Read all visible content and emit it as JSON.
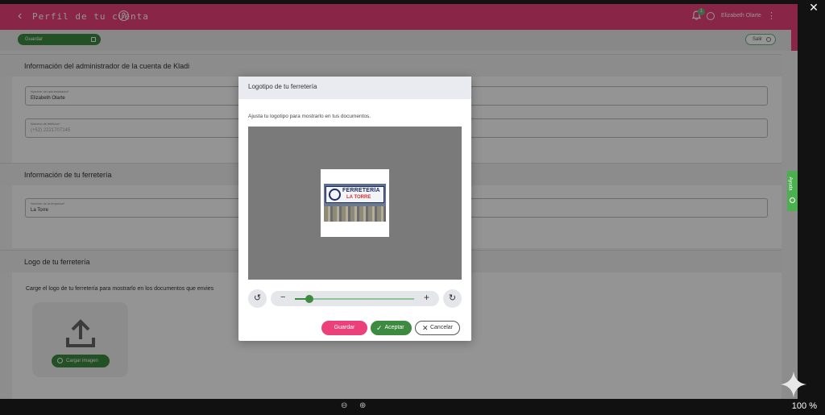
{
  "viewer": {
    "close_label": "✕",
    "zoom_level": "100 %"
  },
  "header": {
    "back_icon": "‹",
    "title": "Perfil de tu cuenta",
    "help_icon": "?",
    "notification_count": "1",
    "user_name": "Elizabeth Olarte",
    "more_icon": "⋮"
  },
  "actions": {
    "save_label": "Guardar",
    "exit_label": "Salir"
  },
  "admin_section": {
    "title": "Información del administrador de la cuenta de Kladi",
    "name_label": "Nombre del administrador*",
    "name_value": "Elizabeth Olarte",
    "phone_label": "Número de teléfono*",
    "phone_value": "(+52) 2221707145"
  },
  "store_section": {
    "title": "Información de tu ferretería",
    "company_label": "Nombre de la empresa*",
    "company_value": "La Torre"
  },
  "logo_section": {
    "title": "Logo de tu ferretería",
    "description": "Carge el logo de tu ferretería para mostrarlo en los documentos que envies",
    "upload_label": "Cargar imagen"
  },
  "feedback_tab": {
    "label": "Ayuda"
  },
  "modal": {
    "title": "Logotipo de tu ferretería",
    "description": "Ajusta tu logotipo para mostrarlo en tus documentos.",
    "logo_line1": "FERRETERÍA",
    "logo_line2": "LA TORRE",
    "rotate_left_icon": "↺",
    "rotate_right_icon": "↻",
    "zoom_minus": "−",
    "zoom_plus": "+",
    "zoom_value": 0.12,
    "save_label": "Guardar",
    "accept_label": "Aceptar",
    "cancel_label": "Cancelar"
  },
  "colors": {
    "brand": "#ec407a",
    "primary": "#3d8b40",
    "accent": "#4caf50"
  }
}
